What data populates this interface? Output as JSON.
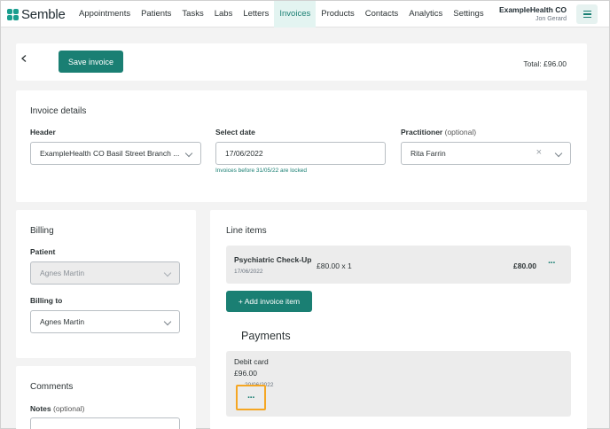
{
  "brand": {
    "name": "Semble",
    "accent": "#1a7f73"
  },
  "nav": {
    "items": [
      {
        "label": "Appointments",
        "active": false
      },
      {
        "label": "Patients",
        "active": false
      },
      {
        "label": "Tasks",
        "active": false
      },
      {
        "label": "Labs",
        "active": false
      },
      {
        "label": "Letters",
        "active": false
      },
      {
        "label": "Invoices",
        "active": true
      },
      {
        "label": "Products",
        "active": false
      },
      {
        "label": "Contacts",
        "active": false
      },
      {
        "label": "Analytics",
        "active": false
      },
      {
        "label": "Settings",
        "active": false
      }
    ],
    "org_name": "ExampleHealth CO",
    "user_name": "Jon Gerard",
    "menu_icon": "hamburger-icon"
  },
  "toolbar": {
    "back_icon": "chevron-left-icon",
    "save_label": "Save invoice",
    "total": "Total: £96.00"
  },
  "invoice_details": {
    "title": "Invoice details",
    "header_label": "Header",
    "header_value": "ExampleHealth CO Basil Street Branch ...",
    "date_label": "Select date",
    "date_value": "17/06/2022",
    "date_hint": "Invoices before 31/05/22 are locked",
    "practitioner_label": "Practitioner",
    "practitioner_optional": "(optional)",
    "practitioner_value": "Rita Farrin",
    "clear_symbol": "×"
  },
  "billing": {
    "title": "Billing",
    "patient_label": "Patient",
    "patient_value": "Agnes Martin",
    "billing_to_label": "Billing to",
    "billing_to_value": "Agnes Martin"
  },
  "comments": {
    "title": "Comments",
    "notes_label": "Notes",
    "notes_optional": "(optional)"
  },
  "line_items": {
    "title": "Line items",
    "items": [
      {
        "name": "Psychiatric Check-Up",
        "date": "17/06/2022",
        "qty": "£80.00 x 1",
        "price": "£80.00",
        "menu": "···"
      }
    ],
    "add_label": "+ Add invoice item"
  },
  "payments": {
    "title": "Payments",
    "items": [
      {
        "method": "Debit card",
        "amount": "£96.00",
        "date": "20/06/2022",
        "menu": "···"
      }
    ]
  }
}
